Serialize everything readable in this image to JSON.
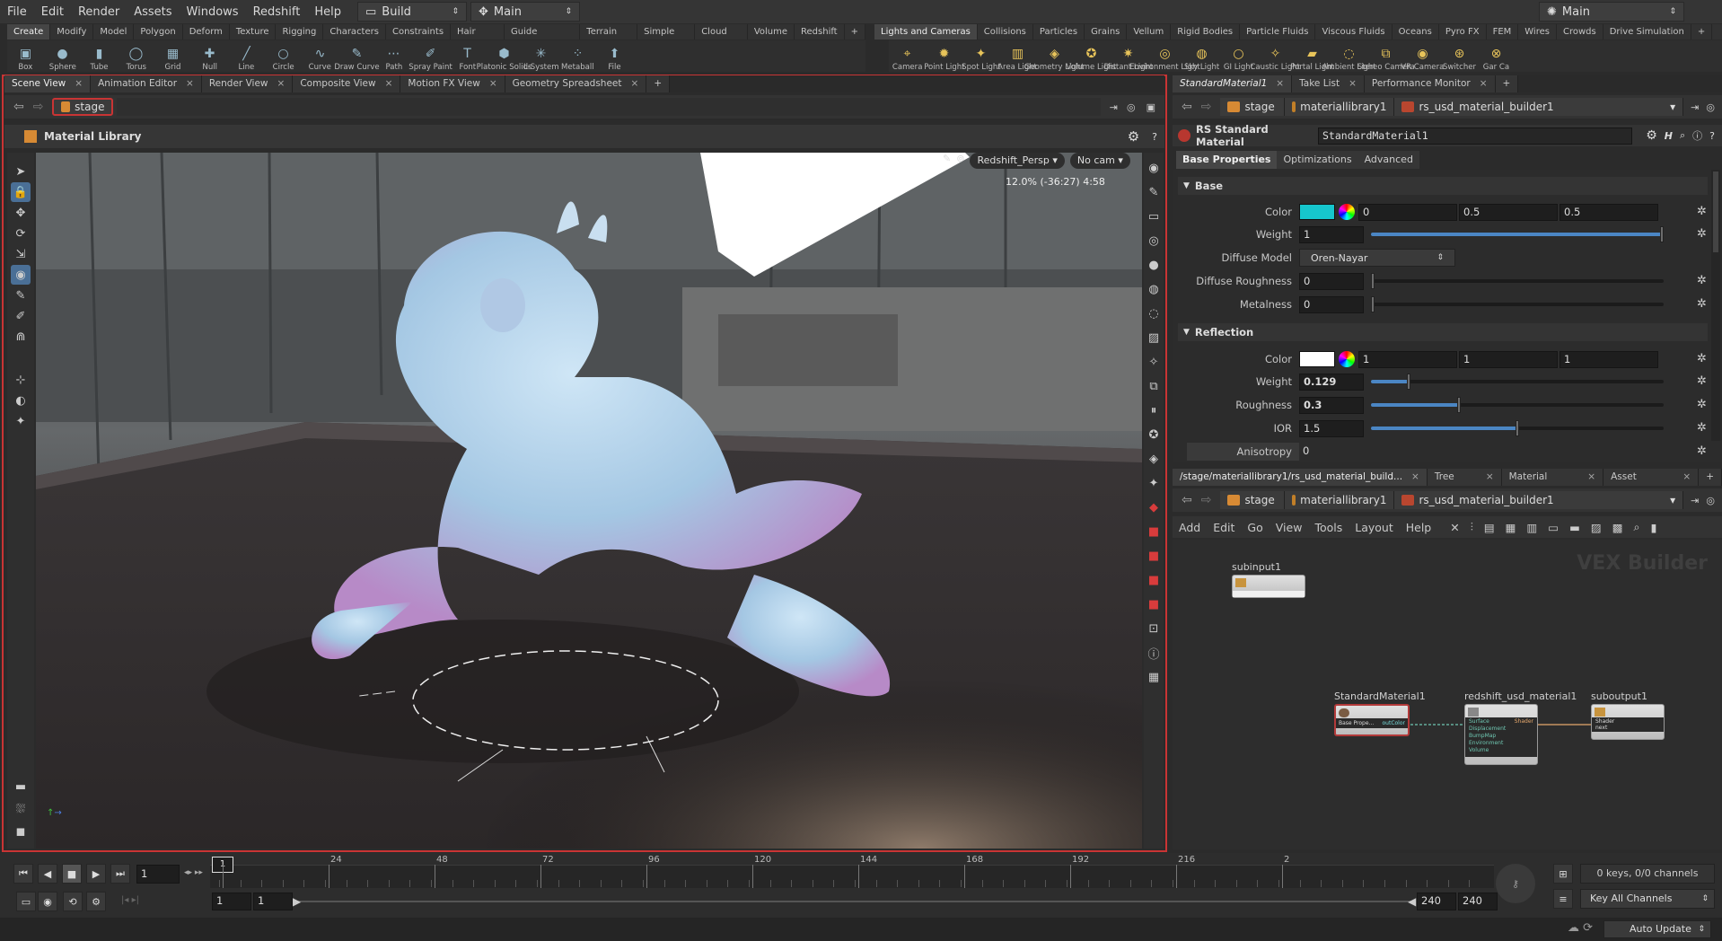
{
  "menu": {
    "items": [
      "File",
      "Edit",
      "Render",
      "Assets",
      "Windows",
      "Redshift",
      "Help"
    ],
    "desktop_left": "Build",
    "context_left": "Main",
    "desktop_right": "Main"
  },
  "shelf_tabs_left": [
    "Create",
    "Modify",
    "Model",
    "Polygon",
    "Deform",
    "Texture",
    "Rigging",
    "Characters",
    "Constraints",
    "Hair Utils",
    "Guide Process",
    "Terrain FX",
    "Simple FX",
    "Cloud FX",
    "Volume",
    "Redshift"
  ],
  "shelf_tools_left": [
    {
      "label": "Box",
      "icon": "box-icon"
    },
    {
      "label": "Sphere",
      "icon": "sphere-icon"
    },
    {
      "label": "Tube",
      "icon": "tube-icon"
    },
    {
      "label": "Torus",
      "icon": "torus-icon"
    },
    {
      "label": "Grid",
      "icon": "grid-icon"
    },
    {
      "label": "Null",
      "icon": "null-icon"
    },
    {
      "label": "Line",
      "icon": "line-icon"
    },
    {
      "label": "Circle",
      "icon": "circle-icon"
    },
    {
      "label": "Curve",
      "icon": "curve-icon"
    },
    {
      "label": "Draw Curve",
      "icon": "draw-curve-icon"
    },
    {
      "label": "Path",
      "icon": "path-icon"
    },
    {
      "label": "Spray Paint",
      "icon": "spray-icon"
    },
    {
      "label": "Font",
      "icon": "font-icon"
    },
    {
      "label": "Platonic Solids",
      "icon": "platonic-icon"
    },
    {
      "label": "L-System",
      "icon": "lsystem-icon"
    },
    {
      "label": "Metaball",
      "icon": "metaball-icon"
    },
    {
      "label": "File",
      "icon": "file-icon"
    }
  ],
  "shelf_tabs_right": [
    "Lights and Cameras",
    "Collisions",
    "Particles",
    "Grains",
    "Vellum",
    "Rigid Bodies",
    "Particle Fluids",
    "Viscous Fluids",
    "Oceans",
    "Pyro FX",
    "FEM",
    "Wires",
    "Crowds",
    "Drive Simulation"
  ],
  "shelf_tools_right": [
    {
      "label": "Camera"
    },
    {
      "label": "Point Light"
    },
    {
      "label": "Spot Light"
    },
    {
      "label": "Area Light"
    },
    {
      "label": "Geometry Light"
    },
    {
      "label": "Volume Light"
    },
    {
      "label": "Distant Light"
    },
    {
      "label": "Environment Light"
    },
    {
      "label": "Sky Light"
    },
    {
      "label": "GI Light"
    },
    {
      "label": "Caustic Light"
    },
    {
      "label": "Portal Light"
    },
    {
      "label": "Ambient Light"
    },
    {
      "label": "Stereo Camera"
    },
    {
      "label": "VR Camera"
    },
    {
      "label": "Switcher"
    },
    {
      "label": "Gar Ca"
    }
  ],
  "left_pane_tabs": [
    "Scene View",
    "Animation Editor",
    "Render View",
    "Composite View",
    "Motion FX View",
    "Geometry Spreadsheet"
  ],
  "left_path": "stage",
  "viewport": {
    "title": "Material Library",
    "camera": "Redshift_Persp",
    "nocam": "No cam",
    "readout": "12.0%  (-36:27)  4:58"
  },
  "right_top_tabs": [
    "StandardMaterial1",
    "Take List",
    "Performance Monitor"
  ],
  "right_path": [
    "stage",
    "materiallibrary1",
    "rs_usd_material_builder1"
  ],
  "params": {
    "type_label": "RS Standard Material",
    "node_name": "StandardMaterial1",
    "tabs": [
      "Base Properties",
      "Optimizations",
      "Advanced"
    ],
    "base_section": "Base",
    "reflection_section": "Reflection",
    "base_color": {
      "label": "Color",
      "r": "0",
      "g": "0.5",
      "b": "0.5",
      "swatch": "#16c6cd"
    },
    "base_weight": {
      "label": "Weight",
      "value": "1",
      "fraction": 1.0
    },
    "diffuse_model": {
      "label": "Diffuse Model",
      "value": "Oren-Nayar"
    },
    "diffuse_roughness": {
      "label": "Diffuse Roughness",
      "value": "0",
      "fraction": 0.0
    },
    "metalness": {
      "label": "Metalness",
      "value": "0",
      "fraction": 0.0
    },
    "refl_color": {
      "label": "Color",
      "r": "1",
      "g": "1",
      "b": "1",
      "swatch": "#ffffff"
    },
    "refl_weight": {
      "label": "Weight",
      "value": "0.129",
      "fraction": 0.129
    },
    "refl_roughness": {
      "label": "Roughness",
      "value": "0.3",
      "fraction": 0.3
    },
    "ior": {
      "label": "IOR",
      "value": "1.5",
      "fraction": 0.5
    },
    "anisotropy": {
      "label": "Anisotropy",
      "value": "0"
    }
  },
  "network_tabs": [
    "/stage/materiallibrary1/rs_usd_material_build...",
    "Tree View",
    "Material Palette",
    "Asset Browser"
  ],
  "network_path": [
    "stage",
    "materiallibrary1",
    "rs_usd_material_builder1"
  ],
  "network_menu": [
    "Add",
    "Edit",
    "Go",
    "View",
    "Tools",
    "Layout",
    "Help"
  ],
  "network_watermark": "VEX Builder",
  "nodes": [
    {
      "name": "subinput1"
    },
    {
      "name": "StandardMaterial1",
      "in": "Base Prope...",
      "out": "outColor"
    },
    {
      "name": "redshift_usd_material1",
      "ports": [
        "Surface",
        "Displacement",
        "BumpMap",
        "Environment",
        "Volume"
      ],
      "out": "Shader"
    },
    {
      "name": "suboutput1",
      "ports": [
        "Shader",
        "next"
      ]
    }
  ],
  "timeline": {
    "frame": "1",
    "start": "1",
    "start2": "1",
    "end": "240",
    "end2": "240",
    "marks": [
      "1",
      "24",
      "48",
      "72",
      "96",
      "120",
      "144",
      "168",
      "192",
      "216",
      "2"
    ],
    "keys": "0 keys, 0/0 channels",
    "key_mode": "Key All Channels",
    "auto_update": "Auto Update"
  }
}
